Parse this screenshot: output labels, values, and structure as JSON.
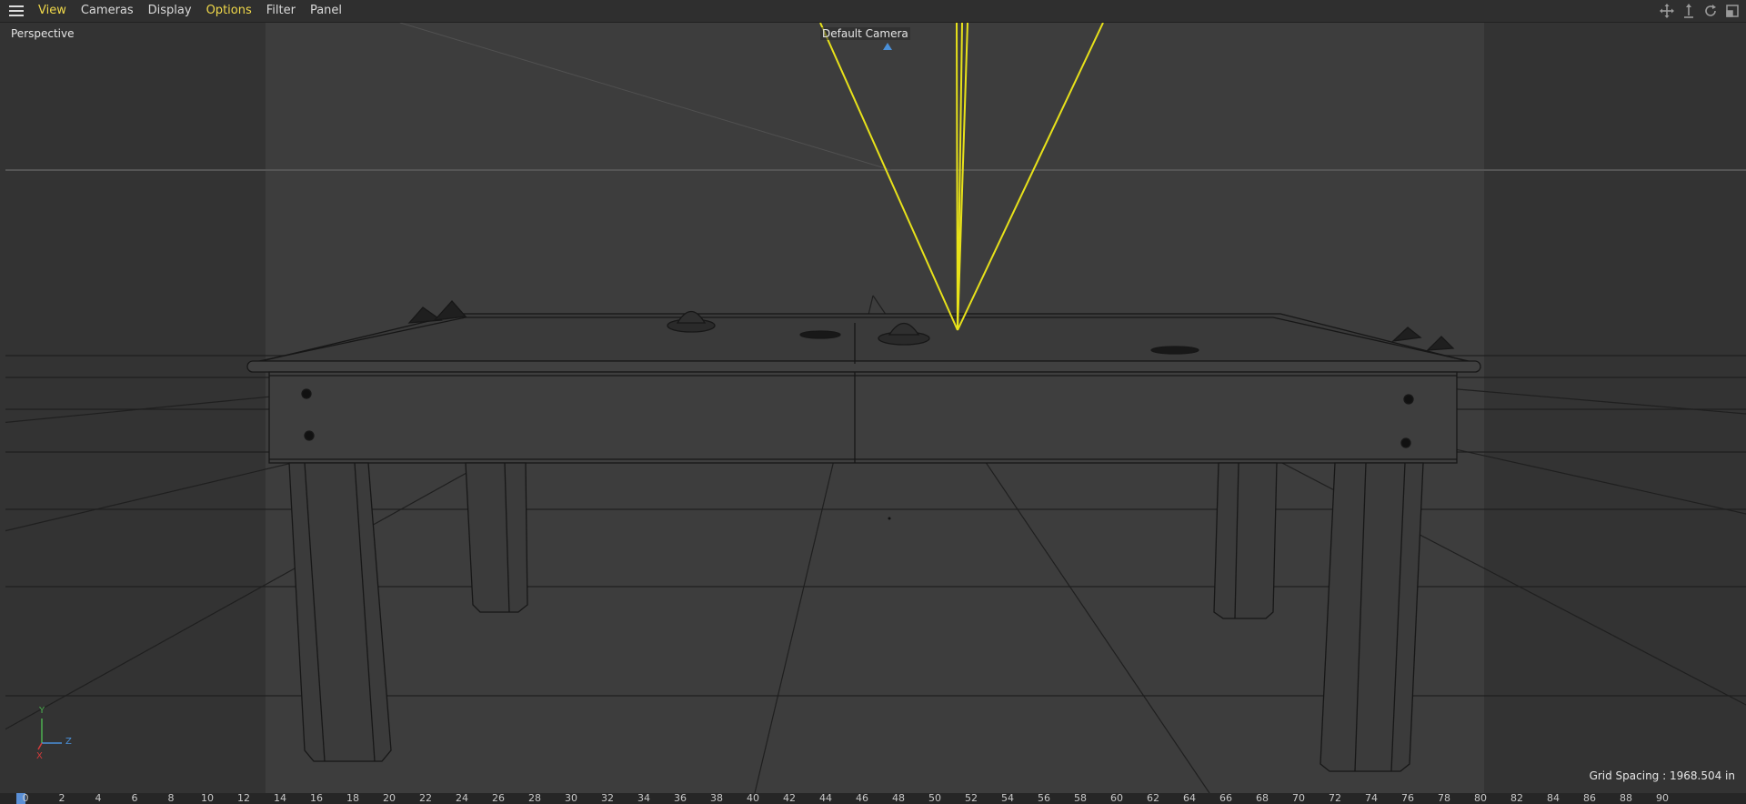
{
  "menu": {
    "items": [
      {
        "label": "View",
        "active": true
      },
      {
        "label": "Cameras",
        "active": false
      },
      {
        "label": "Display",
        "active": false
      },
      {
        "label": "Options",
        "active": true
      },
      {
        "label": "Filter",
        "active": false
      },
      {
        "label": "Panel",
        "active": false
      }
    ],
    "nav_icons": [
      "move-view-icon",
      "dolly-view-icon",
      "rotate-view-icon",
      "maximize-view-icon"
    ]
  },
  "viewport": {
    "label": "Perspective",
    "camera_label": "Default Camera",
    "grid_spacing": "Grid Spacing : 1968.504 in",
    "axis": {
      "y": "Y",
      "z": "Z",
      "x": "X"
    }
  },
  "timeline": {
    "ticks": [
      "0",
      "2",
      "4",
      "6",
      "8",
      "10",
      "12",
      "14",
      "16",
      "18",
      "20",
      "22",
      "24",
      "26",
      "28",
      "30",
      "32",
      "34",
      "36",
      "38",
      "40",
      "42",
      "44",
      "46",
      "48",
      "50",
      "52",
      "54",
      "56",
      "58",
      "60",
      "62",
      "64",
      "66",
      "68",
      "70",
      "72",
      "74",
      "76",
      "78",
      "80",
      "82",
      "84",
      "86",
      "88",
      "90"
    ],
    "current_frame": "0"
  },
  "colors": {
    "accent": "#f0d84a",
    "camera_frustum": "#e8e21a",
    "axis_x": "#d23b3b",
    "axis_y": "#4caf50",
    "axis_z": "#4a90d9",
    "playhead": "#5a8fd6"
  }
}
